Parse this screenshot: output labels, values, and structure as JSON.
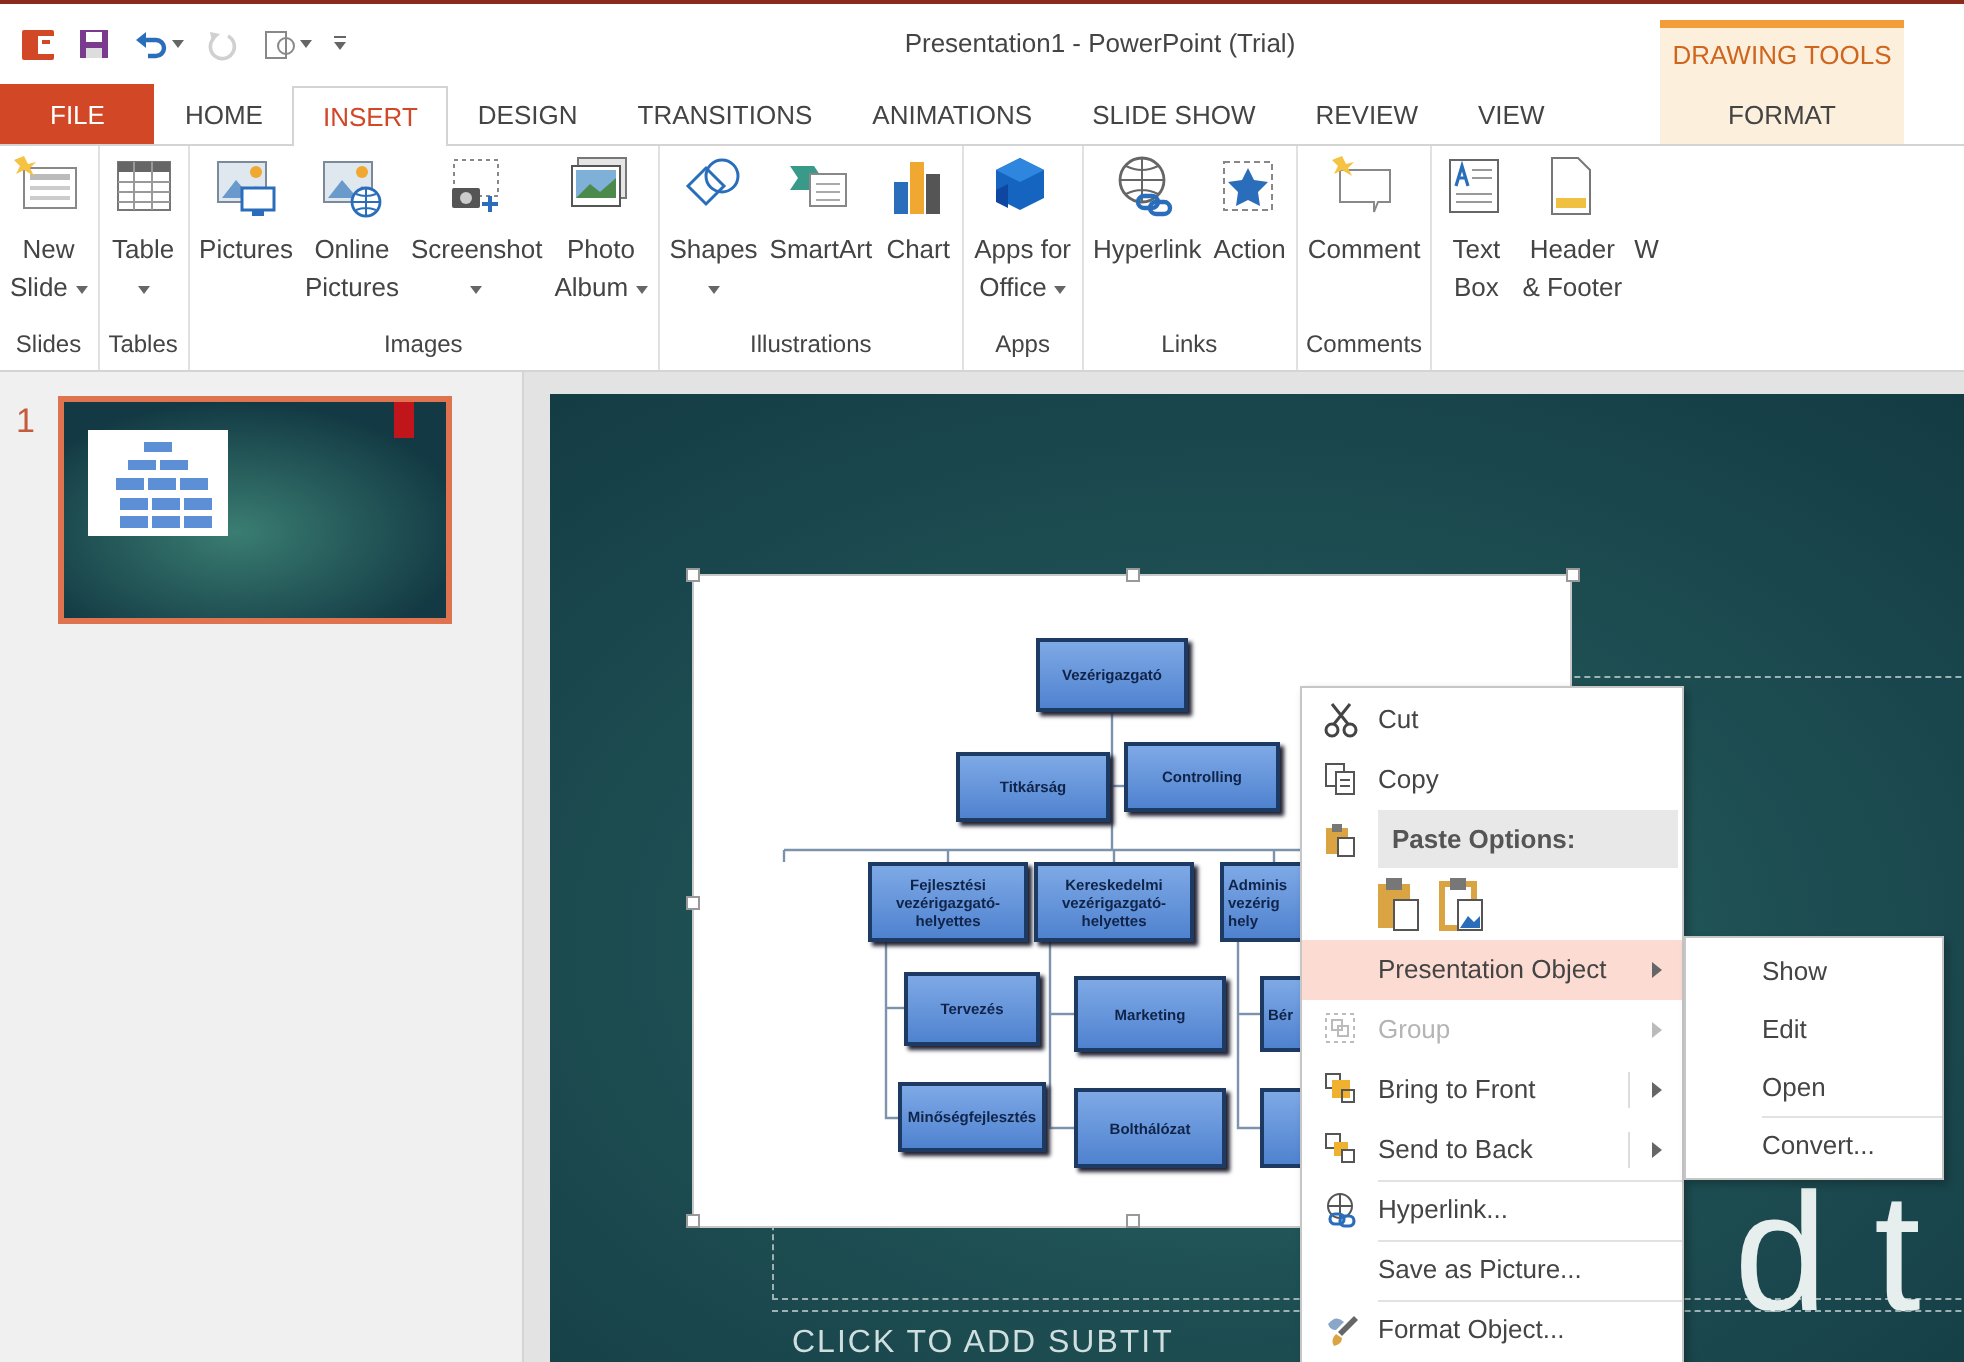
{
  "title_bar": {
    "quick_access": [
      {
        "caret": false,
        "disabled": false
      },
      {
        "caret": false,
        "disabled": false
      },
      {
        "caret": true,
        "disabled": false
      },
      {
        "caret": false,
        "disabled": true
      },
      {
        "caret": true,
        "disabled": false
      },
      {
        "caret": false,
        "disabled": false
      }
    ],
    "title": "Presentation1 - PowerPoint (Trial)",
    "contextual_label": "DRAWING TOOLS"
  },
  "tabs": [
    {
      "label": "FILE",
      "kind": "file",
      "selected": false
    },
    {
      "label": "HOME",
      "kind": "tab",
      "selected": false
    },
    {
      "label": "INSERT",
      "kind": "tab",
      "selected": true
    },
    {
      "label": "DESIGN",
      "kind": "tab",
      "selected": false
    },
    {
      "label": "TRANSITIONS",
      "kind": "tab",
      "selected": false
    },
    {
      "label": "ANIMATIONS",
      "kind": "tab",
      "selected": false
    },
    {
      "label": "SLIDE SHOW",
      "kind": "tab",
      "selected": false
    },
    {
      "label": "REVIEW",
      "kind": "tab",
      "selected": false
    },
    {
      "label": "VIEW",
      "kind": "tab",
      "selected": false
    },
    {
      "label": "FORMAT",
      "kind": "contextual",
      "selected": false
    }
  ],
  "ribbon": {
    "groups": [
      {
        "label": "Slides",
        "buttons": [
          {
            "lines": [
              "New",
              "Slide"
            ],
            "caret": true
          }
        ]
      },
      {
        "label": "Tables",
        "buttons": [
          {
            "lines": [
              "Table"
            ],
            "caret": true
          }
        ]
      },
      {
        "label": "Images",
        "buttons": [
          {
            "lines": [
              "Pictures"
            ],
            "caret": false
          },
          {
            "lines": [
              "Online",
              "Pictures"
            ],
            "caret": false
          },
          {
            "lines": [
              "Screenshot"
            ],
            "caret": true
          },
          {
            "lines": [
              "Photo",
              "Album"
            ],
            "caret": true
          }
        ]
      },
      {
        "label": "Illustrations",
        "buttons": [
          {
            "lines": [
              "Shapes"
            ],
            "caret": true
          },
          {
            "lines": [
              "SmartArt"
            ],
            "caret": false
          },
          {
            "lines": [
              "Chart"
            ],
            "caret": false
          }
        ]
      },
      {
        "label": "Apps",
        "buttons": [
          {
            "lines": [
              "Apps for",
              "Office"
            ],
            "caret": true
          }
        ]
      },
      {
        "label": "Links",
        "buttons": [
          {
            "lines": [
              "Hyperlink"
            ],
            "caret": false
          },
          {
            "lines": [
              "Action"
            ],
            "caret": false
          }
        ]
      },
      {
        "label": "Comments",
        "buttons": [
          {
            "lines": [
              "Comment"
            ],
            "caret": false
          }
        ]
      },
      {
        "buttons": [
          {
            "lines": [
              "Text",
              "Box"
            ],
            "caret": false
          },
          {
            "lines": [
              "Header",
              "& Footer"
            ],
            "caret": false
          },
          {
            "lines": [
              "W"
            ],
            "caret": false
          }
        ]
      }
    ]
  },
  "slides": [
    {
      "number": "1",
      "selected": true
    }
  ],
  "slide": {
    "title_placeholder": "d t",
    "subtitle_placeholder": "CLICK TO ADD SUBTIT",
    "org_chart": [
      {
        "kind": "label",
        "lines": [
          "Vezérigazgató"
        ]
      },
      {
        "kind": "label",
        "lines": [
          "Titkárság"
        ]
      },
      {
        "kind": "label",
        "lines": [
          "Controlling"
        ]
      },
      {
        "kind": "label",
        "lines": [
          "Fejlesztési",
          "vezérigazgató-",
          "helyettes"
        ]
      },
      {
        "kind": "label",
        "lines": [
          "Kereskedelmi",
          "vezérigazgató-",
          "helyettes"
        ]
      },
      {
        "kind": "label",
        "lines": [
          "Adminis",
          "vezérig",
          "hely"
        ]
      },
      {
        "kind": "label",
        "lines": [
          "Tervezés"
        ]
      },
      {
        "kind": "label",
        "lines": [
          "Marketing"
        ]
      },
      {
        "kind": "label",
        "lines": [
          "Bér"
        ]
      },
      {
        "kind": "label",
        "lines": [
          "Minőségfejlesztés"
        ]
      },
      {
        "kind": "label",
        "lines": [
          "Bolthálózat"
        ]
      },
      {
        "kind": "blank"
      }
    ]
  },
  "context_menu": {
    "items": [
      {
        "kind": "item",
        "label": "Cut",
        "submenu": false,
        "split": false,
        "selected": false,
        "disabled": false,
        "separator_above": false
      },
      {
        "kind": "item",
        "label": "Copy",
        "submenu": false,
        "split": false,
        "selected": false,
        "disabled": false,
        "separator_above": false
      },
      {
        "kind": "header",
        "label": "Paste Options:"
      },
      {
        "kind": "paste_options"
      },
      {
        "kind": "item",
        "label": "Presentation Object",
        "submenu": true,
        "split": false,
        "selected": true,
        "disabled": false,
        "separator_above": false
      },
      {
        "kind": "item",
        "label": "Group",
        "submenu": true,
        "split": false,
        "selected": false,
        "disabled": true,
        "separator_above": false
      },
      {
        "kind": "item",
        "label": "Bring to Front",
        "submenu": true,
        "split": true,
        "selected": false,
        "disabled": false,
        "separator_above": false
      },
      {
        "kind": "item",
        "label": "Send to Back",
        "submenu": true,
        "split": true,
        "selected": false,
        "disabled": false,
        "separator_above": false
      },
      {
        "kind": "item",
        "label": "Hyperlink...",
        "submenu": false,
        "split": false,
        "selected": false,
        "disabled": false,
        "separator_above": true
      },
      {
        "kind": "item",
        "label": "Save as Picture...",
        "submenu": false,
        "split": false,
        "selected": false,
        "disabled": false,
        "separator_above": true
      },
      {
        "kind": "item",
        "label": "Format Object...",
        "submenu": false,
        "split": false,
        "selected": false,
        "disabled": false,
        "separator_above": true
      }
    ]
  },
  "submenu": {
    "items": [
      {
        "label": "Show",
        "separator_above": false
      },
      {
        "label": "Edit",
        "separator_above": false
      },
      {
        "label": "Open",
        "separator_above": false
      },
      {
        "label": "Convert...",
        "separator_above": true
      }
    ]
  }
}
